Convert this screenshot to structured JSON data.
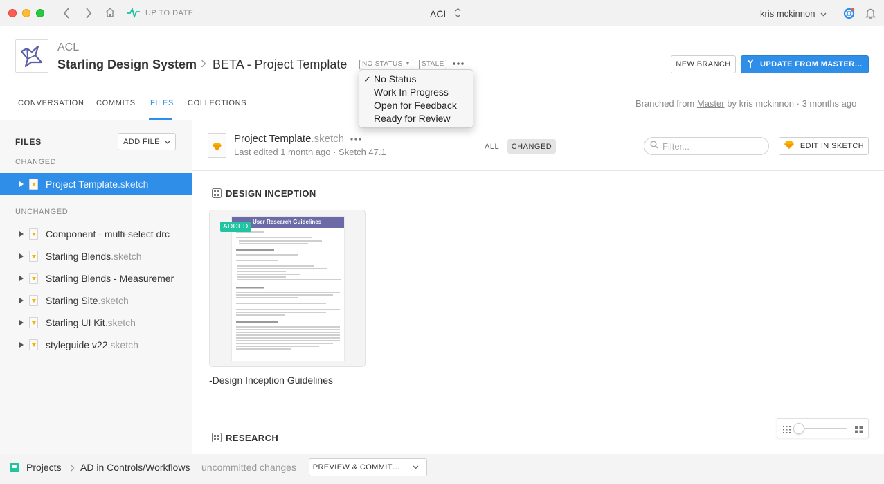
{
  "titlebar": {
    "status": "UP TO DATE",
    "project_selector": "ACL",
    "user": "kris mckinnon"
  },
  "header": {
    "org": "ACL",
    "project": "Starling Design System",
    "branch": "BETA - Project Template",
    "status_tag": "NO STATUS",
    "stale_tag": "STALE",
    "new_branch_label": "NEW BRANCH",
    "update_label": "UPDATE FROM MASTER…",
    "accent": "#2f8ee8"
  },
  "status_menu": {
    "items": [
      "No Status",
      "Work In Progress",
      "Open for Feedback",
      "Ready for Review"
    ],
    "checked": "No Status"
  },
  "tabs": {
    "items": [
      "CONVERSATION",
      "COMMITS",
      "FILES",
      "COLLECTIONS"
    ],
    "active": "FILES",
    "branch_info_prefix": "Branched from ",
    "branch_info_link": "Master",
    "branch_info_suffix": " by kris mckinnon · 3 months ago"
  },
  "sidebar": {
    "title": "FILES",
    "add_file_label": "ADD FILE",
    "changed_heading": "CHANGED",
    "unchanged_heading": "UNCHANGED",
    "changed": [
      {
        "name": "Project Template",
        "ext": ".sketch"
      }
    ],
    "unchanged": [
      {
        "name": "Component - multi-select drc",
        "ext": ""
      },
      {
        "name": "Starling Blends",
        "ext": ".sketch"
      },
      {
        "name": "Starling Blends - Measuremer",
        "ext": ""
      },
      {
        "name": "Starling Site",
        "ext": ".sketch"
      },
      {
        "name": "Starling UI Kit",
        "ext": ".sketch"
      },
      {
        "name": "styleguide v22",
        "ext": ".sketch"
      }
    ]
  },
  "file_header": {
    "name": "Project Template",
    "ext": ".sketch",
    "edited_prefix": "Last edited ",
    "edited_link": "1 month ago",
    "edited_suffix": " · Sketch 47.1",
    "filter_all": "ALL",
    "filter_changed": "CHANGED",
    "filter_placeholder": "Filter...",
    "edit_label": "EDIT IN SKETCH"
  },
  "content": {
    "section1": "DESIGN INCEPTION",
    "artboard_badge": "ADDED",
    "artboard_doc_title": "User Research Guidelines",
    "artboard_name": "-Design Inception Guidelines",
    "section2": "RESEARCH"
  },
  "footer": {
    "projects": "Projects",
    "branch": "AD in Controls/Workflows",
    "changes": "uncommitted changes",
    "commit_label": "PREVIEW & COMMIT…"
  },
  "zoom": {
    "level": 0.05
  }
}
